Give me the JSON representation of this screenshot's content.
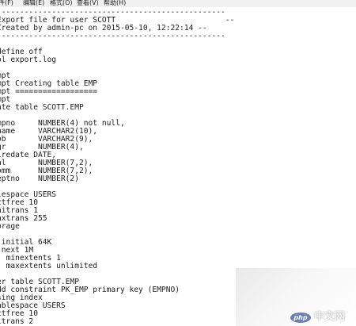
{
  "menu": {
    "items": [
      {
        "label": "件(F)"
      },
      {
        "label": "编辑(E)"
      },
      {
        "label": "格式(O)"
      },
      {
        "label": "查看(V)"
      },
      {
        "label": "帮助(H)"
      }
    ]
  },
  "editor": {
    "lines": [
      "--------------------------------------------------",
      "Export file for user SCOTT                        --",
      "Created by admin-pc on 2015-05-10, 12:22:14 --",
      "--------------------------------------------------",
      "",
      "define off",
      "ol export.log",
      "",
      "mpt",
      "mpt Creating table EMP",
      "mpt ==================",
      "mpt",
      "ate table SCOTT.EMP",
      "",
      "mpno     NUMBER(4) not null,",
      "name     VARCHAR2(10),",
      "ob       VARCHAR2(9),",
      "gr       NUMBER(4),",
      "iredate DATE,",
      "al       NUMBER(7,2),",
      "omm      NUMBER(7,2),",
      "eptno    NUMBER(2)",
      "",
      "lespace USERS",
      "ctfree 10",
      "nitrans 1",
      "axtrans 255",
      "orage",
      "",
      " initial 64K",
      " next 1M",
      "  minextents 1",
      "  maxextents unlimited",
      "",
      "er table SCOTT.EMP",
      "dd constraint PK_EMP primary key (EMPNO)",
      "sing index",
      "ablespace USERS",
      "ctfree 10",
      "itrans 2"
    ]
  },
  "watermark": {
    "logo_label": "php",
    "site_label": "中文网"
  }
}
